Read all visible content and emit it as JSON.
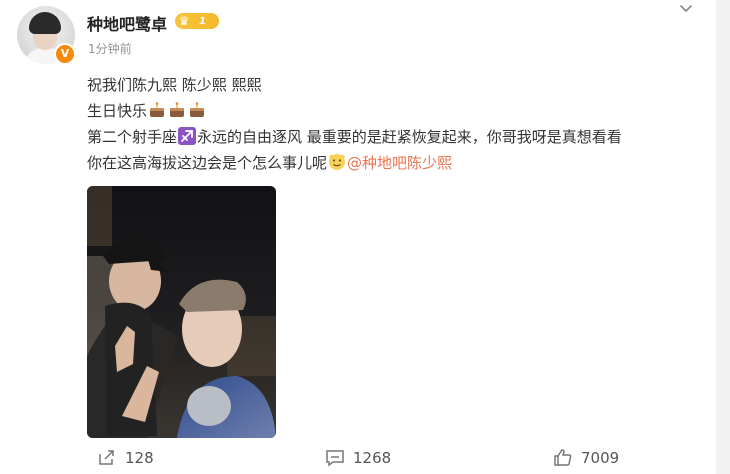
{
  "post": {
    "username": "种地吧鹭卓",
    "vip_level": "1",
    "timestamp": "1分钟前",
    "verified_badge": "V",
    "lines": [
      "祝我们陈九熙 陈少熙 熙熙",
      "生日快乐",
      "第二个射手座",
      "永远的自由逐风 最重要的是赶紧恢复起来，你哥我呀是真想看看",
      "你在这高海拔这边会是个怎么事儿呢",
      "@种地吧陈少熙"
    ],
    "icons": [
      "chevron-down-icon",
      "cake-icon",
      "sagittarius-icon",
      "cheeky-face-icon",
      "repost-icon",
      "comment-icon",
      "like-icon",
      "vip-crown-icon",
      "verified-v-icon"
    ],
    "colors": {
      "mention": "#eb7350",
      "badge": "#f78a09",
      "crown": "#f4b82a",
      "sagittarius": "#8c53c5"
    }
  },
  "actions": {
    "repost_count": "128",
    "comment_count": "1268",
    "like_count": "7009"
  }
}
